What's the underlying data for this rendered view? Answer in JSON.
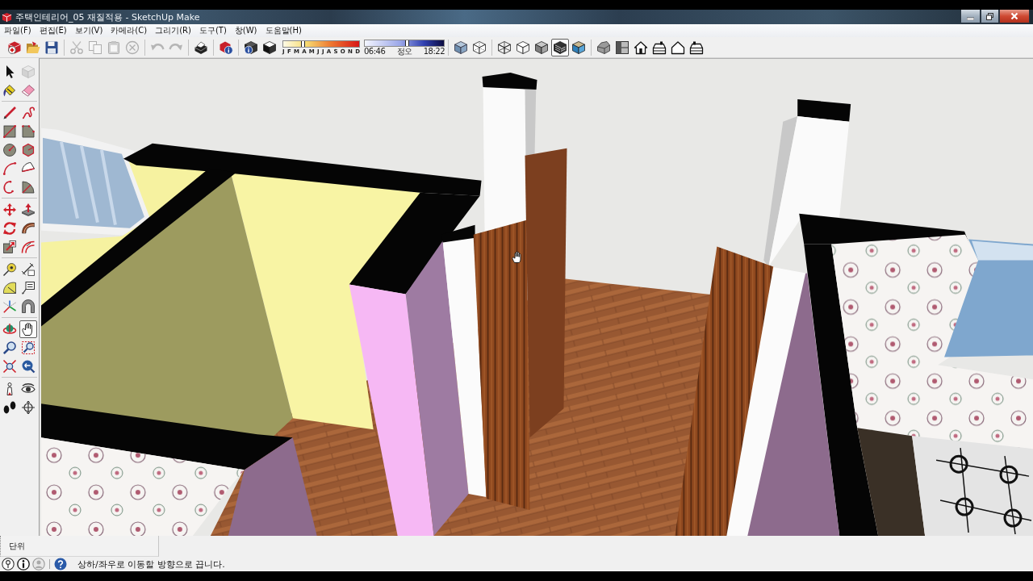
{
  "window": {
    "title": "주택인테리어_05 재질적용 - SketchUp Make"
  },
  "menu": [
    "파일(F)",
    "편집(E)",
    "보기(V)",
    "카메라(C)",
    "그리기(R)",
    "도구(T)",
    "창(W)",
    "도움말(H)"
  ],
  "toolbar": {
    "sections": [
      {
        "kind": "buttons",
        "items": [
          {
            "selected": false,
            "disabled": false
          },
          {
            "selected": false,
            "disabled": false
          },
          {
            "selected": false,
            "disabled": false
          }
        ]
      },
      {
        "kind": "buttons",
        "items": [
          {
            "selected": false,
            "disabled": true
          },
          {
            "selected": false,
            "disabled": true
          },
          {
            "selected": false,
            "disabled": true
          },
          {
            "selected": false,
            "disabled": true
          }
        ]
      },
      {
        "kind": "buttons",
        "items": [
          {
            "selected": false,
            "disabled": true
          },
          {
            "selected": false,
            "disabled": true
          }
        ]
      },
      {
        "kind": "buttons",
        "items": [
          {
            "selected": false,
            "disabled": false
          }
        ]
      },
      {
        "kind": "buttons",
        "items": [
          {
            "selected": false,
            "disabled": false
          }
        ]
      },
      {
        "kind": "shadow",
        "items": [
          {
            "selected": false,
            "disabled": false
          },
          {
            "selected": false,
            "disabled": false
          }
        ],
        "month_slider": {
          "labels": [
            "J",
            "F",
            "M",
            "A",
            "M",
            "J",
            "J",
            "A",
            "S",
            "O",
            "N",
            "D"
          ],
          "level": 0.25
        },
        "time_slider": {
          "labels": [
            "06:46",
            "정오",
            "18:22"
          ],
          "level": 0.53
        }
      },
      {
        "kind": "buttons",
        "items": [
          {
            "selected": false,
            "disabled": false
          },
          {
            "selected": false,
            "disabled": false
          }
        ]
      },
      {
        "kind": "buttons",
        "items": [
          {
            "selected": false,
            "disabled": false
          },
          {
            "selected": false,
            "disabled": false
          },
          {
            "selected": false,
            "disabled": false
          },
          {
            "selected": true,
            "disabled": false
          },
          {
            "selected": false,
            "disabled": false
          }
        ]
      },
      {
        "kind": "buttons",
        "items": [
          {
            "selected": false,
            "disabled": false
          },
          {
            "selected": false,
            "disabled": false
          },
          {
            "selected": false,
            "disabled": false
          },
          {
            "selected": false,
            "disabled": false
          },
          {
            "selected": false,
            "disabled": false
          },
          {
            "selected": false,
            "disabled": false
          }
        ]
      }
    ]
  },
  "tool_palette": {
    "groups": [
      [
        {
          "selected": false,
          "disabled": false
        },
        {
          "selected": false,
          "disabled": true
        },
        {
          "selected": false,
          "disabled": false
        },
        {
          "selected": false,
          "disabled": false
        }
      ],
      [
        {
          "selected": false,
          "disabled": false
        },
        {
          "selected": false,
          "disabled": false
        },
        {
          "selected": false,
          "disabled": false
        },
        {
          "selected": false,
          "disabled": false
        },
        {
          "selected": false,
          "disabled": false
        },
        {
          "selected": false,
          "disabled": false
        },
        {
          "selected": false,
          "disabled": false
        },
        {
          "selected": false,
          "disabled": false
        },
        {
          "selected": false,
          "disabled": false
        },
        {
          "selected": false,
          "disabled": false
        }
      ],
      [
        {
          "selected": false,
          "disabled": false
        },
        {
          "selected": false,
          "disabled": false
        },
        {
          "selected": false,
          "disabled": false
        },
        {
          "selected": false,
          "disabled": false
        },
        {
          "selected": false,
          "disabled": false
        },
        {
          "selected": false,
          "disabled": false
        }
      ],
      [
        {
          "selected": false,
          "disabled": false
        },
        {
          "selected": false,
          "disabled": false
        },
        {
          "selected": false,
          "disabled": false
        },
        {
          "selected": false,
          "disabled": false
        },
        {
          "selected": false,
          "disabled": false
        },
        {
          "selected": false,
          "disabled": false
        }
      ],
      [
        {
          "selected": false,
          "disabled": false
        },
        {
          "selected": true,
          "disabled": false
        },
        {
          "selected": false,
          "disabled": false
        },
        {
          "selected": false,
          "disabled": false
        },
        {
          "selected": false,
          "disabled": false
        },
        {
          "selected": false,
          "disabled": false
        }
      ],
      [
        {
          "selected": false,
          "disabled": false
        },
        {
          "selected": false,
          "disabled": false
        },
        {
          "selected": false,
          "disabled": false
        },
        {
          "selected": false,
          "disabled": false
        }
      ]
    ]
  },
  "measurements": {
    "label": "단위"
  },
  "status_bar": {
    "hint": "상하/좌우로 이동할 방향으로 끕니다."
  }
}
